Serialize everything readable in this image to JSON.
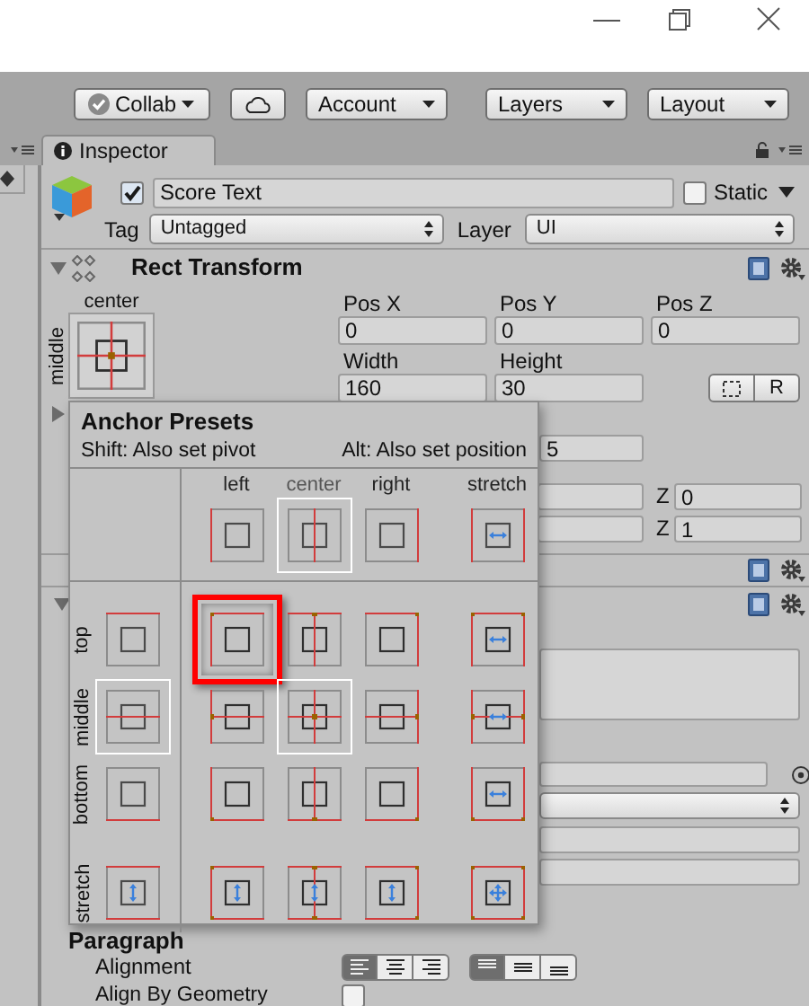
{
  "toolbar": [
    {
      "kind": "collab",
      "label": "Collab"
    },
    {
      "kind": "cloud"
    },
    {
      "kind": "dropdown",
      "label": "Account"
    },
    {
      "kind": "dropdown",
      "label": "Layers"
    },
    {
      "kind": "dropdown",
      "label": "Layout"
    }
  ],
  "inspector_tab": {
    "label": "Inspector"
  },
  "game_object": {
    "active": true,
    "name": "Score Text",
    "static": false,
    "static_label": "Static",
    "tag_label": "Tag",
    "tag": "Untagged",
    "layer_label": "Layer",
    "layer": "UI"
  },
  "rect_transform": {
    "title": "Rect Transform",
    "expanded": true,
    "anchor_column_label": "center",
    "anchor_row_label": "middle",
    "fields": [
      {
        "label": "Pos X",
        "value": "0"
      },
      {
        "label": "Pos Y",
        "value": "0"
      },
      {
        "label": "Pos Z",
        "value": "0"
      },
      {
        "label": "Width",
        "value": "160"
      },
      {
        "label": "Height",
        "value": "30"
      }
    ],
    "raw_edit_label": "R",
    "partial_value": "5",
    "z_rows": [
      {
        "label": "Z",
        "value": "0"
      },
      {
        "label": "Z",
        "value": "1"
      }
    ]
  },
  "text_component": {
    "expanded": true
  },
  "anchor_presets": {
    "title": "Anchor Presets",
    "hint_pivot": "Shift: Also set pivot",
    "hint_position": "Alt: Also set position",
    "columns": [
      {
        "label": "left",
        "selected": false
      },
      {
        "label": "center",
        "selected": true
      },
      {
        "label": "right",
        "selected": false
      },
      {
        "label": "stretch",
        "selected": false
      }
    ],
    "rows": [
      {
        "label": "top",
        "selected": false,
        "cells": [
          {
            "selected": false,
            "highlighted": true
          },
          {
            "selected": false,
            "highlighted": false
          },
          {
            "selected": false,
            "highlighted": false
          },
          {
            "selected": false,
            "highlighted": false
          }
        ]
      },
      {
        "label": "middle",
        "selected": true,
        "cells": [
          {
            "selected": false,
            "highlighted": false
          },
          {
            "selected": true,
            "highlighted": false
          },
          {
            "selected": false,
            "highlighted": false
          },
          {
            "selected": false,
            "highlighted": false
          }
        ]
      },
      {
        "label": "bottom",
        "selected": false,
        "cells": [
          {
            "selected": false,
            "highlighted": false
          },
          {
            "selected": false,
            "highlighted": false
          },
          {
            "selected": false,
            "highlighted": false
          },
          {
            "selected": false,
            "highlighted": false
          }
        ]
      },
      {
        "label": "stretch",
        "selected": false,
        "cells": [
          {
            "selected": false,
            "highlighted": false
          },
          {
            "selected": false,
            "highlighted": false
          },
          {
            "selected": false,
            "highlighted": false
          },
          {
            "selected": false,
            "highlighted": false
          }
        ]
      }
    ]
  },
  "paragraph": {
    "title": "Paragraph",
    "alignment_label": "Alignment",
    "horizontal_alignment": [
      {
        "selected": true
      },
      {
        "selected": false
      },
      {
        "selected": false
      }
    ],
    "vertical_alignment": [
      {
        "selected": true
      },
      {
        "selected": false
      },
      {
        "selected": false
      }
    ],
    "align_by_geometry_label": "Align By Geometry",
    "align_by_geometry": false
  }
}
